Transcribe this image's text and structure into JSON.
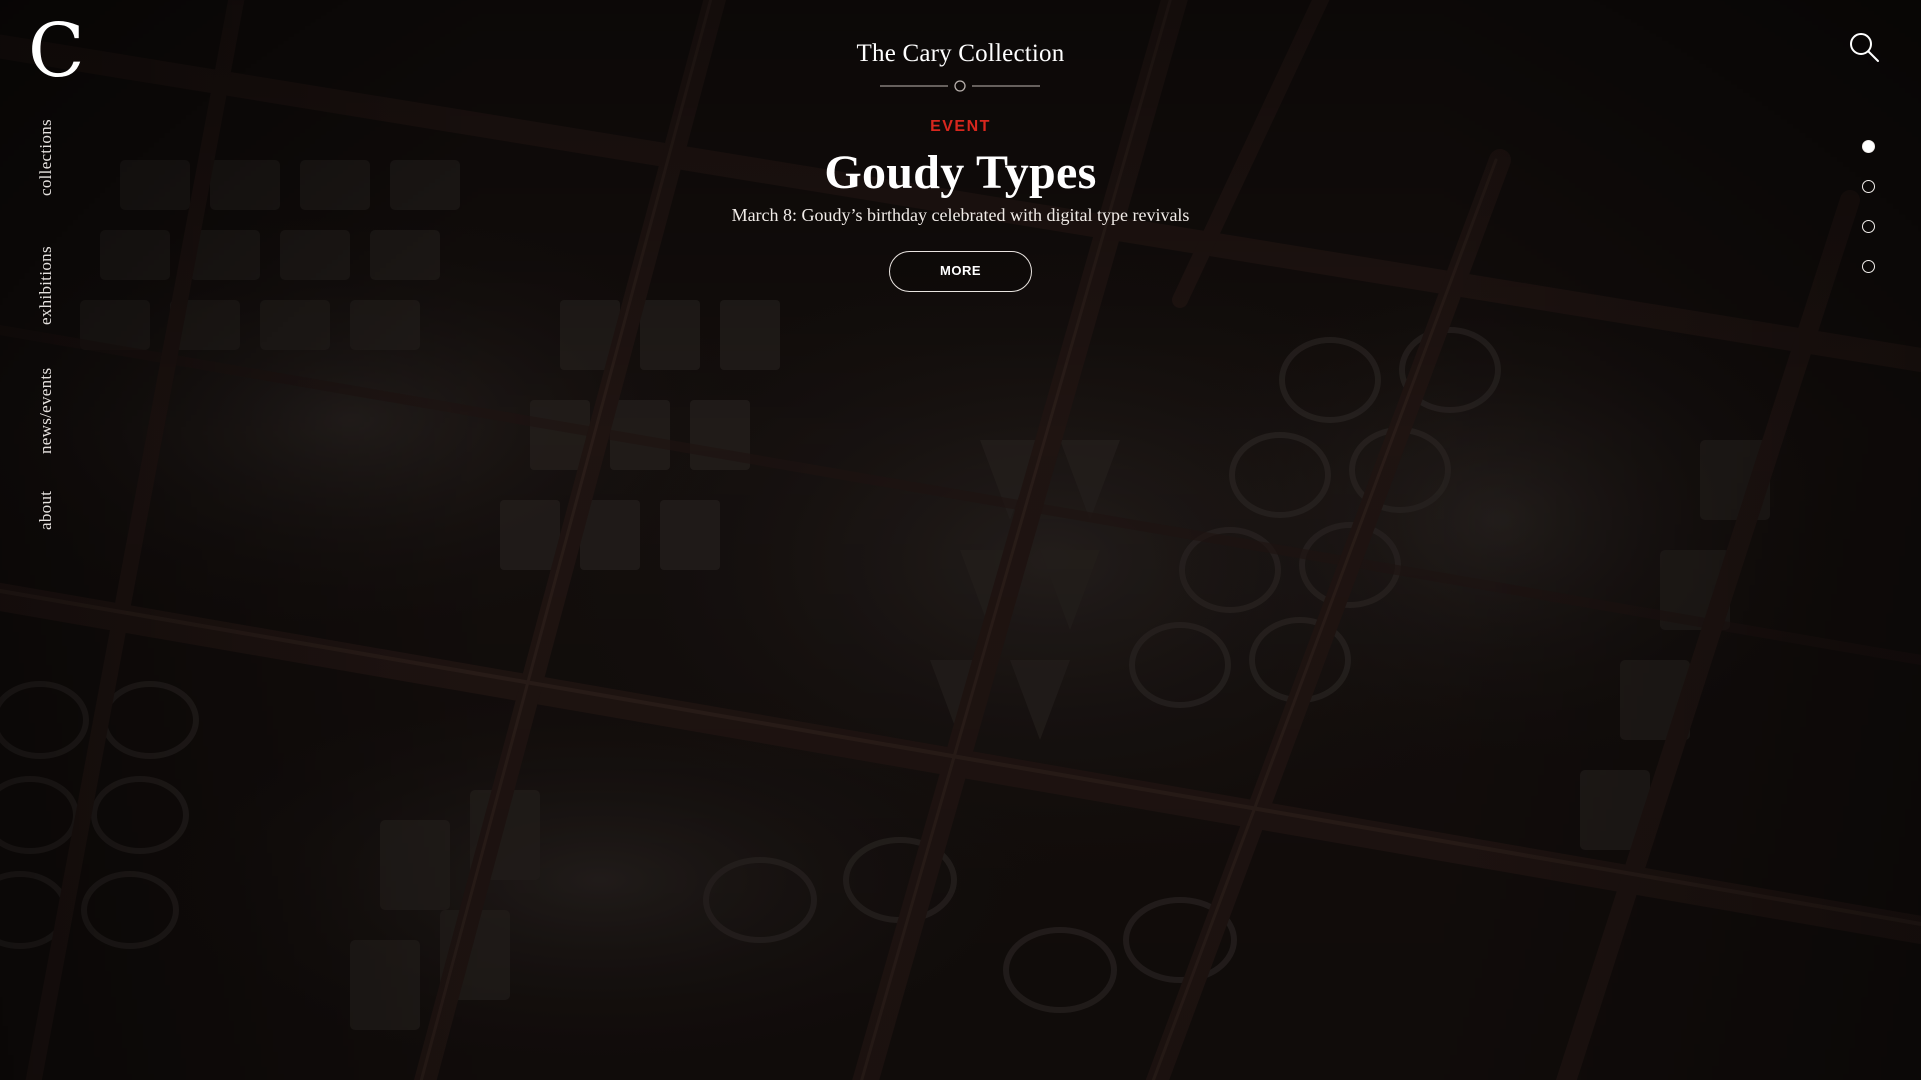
{
  "logo": {
    "letter": "C"
  },
  "nav": {
    "items": [
      {
        "label": "collections"
      },
      {
        "label": "exhibitions"
      },
      {
        "label": "news/events"
      },
      {
        "label": "about"
      }
    ]
  },
  "header": {
    "title": "The Cary Collection"
  },
  "hero": {
    "category": "EVENT",
    "title": "Goudy Types",
    "description": "March 8: Goudy’s birthday celebrated with digital type revivals",
    "button_label": "MORE"
  },
  "slides": {
    "count": 4,
    "active_index": 0
  },
  "icons": {
    "search": "search-icon",
    "ornament": "divider-ornament"
  },
  "colors": {
    "accent": "#d8271e",
    "text": "#ffffff",
    "background": "#120d0b"
  }
}
